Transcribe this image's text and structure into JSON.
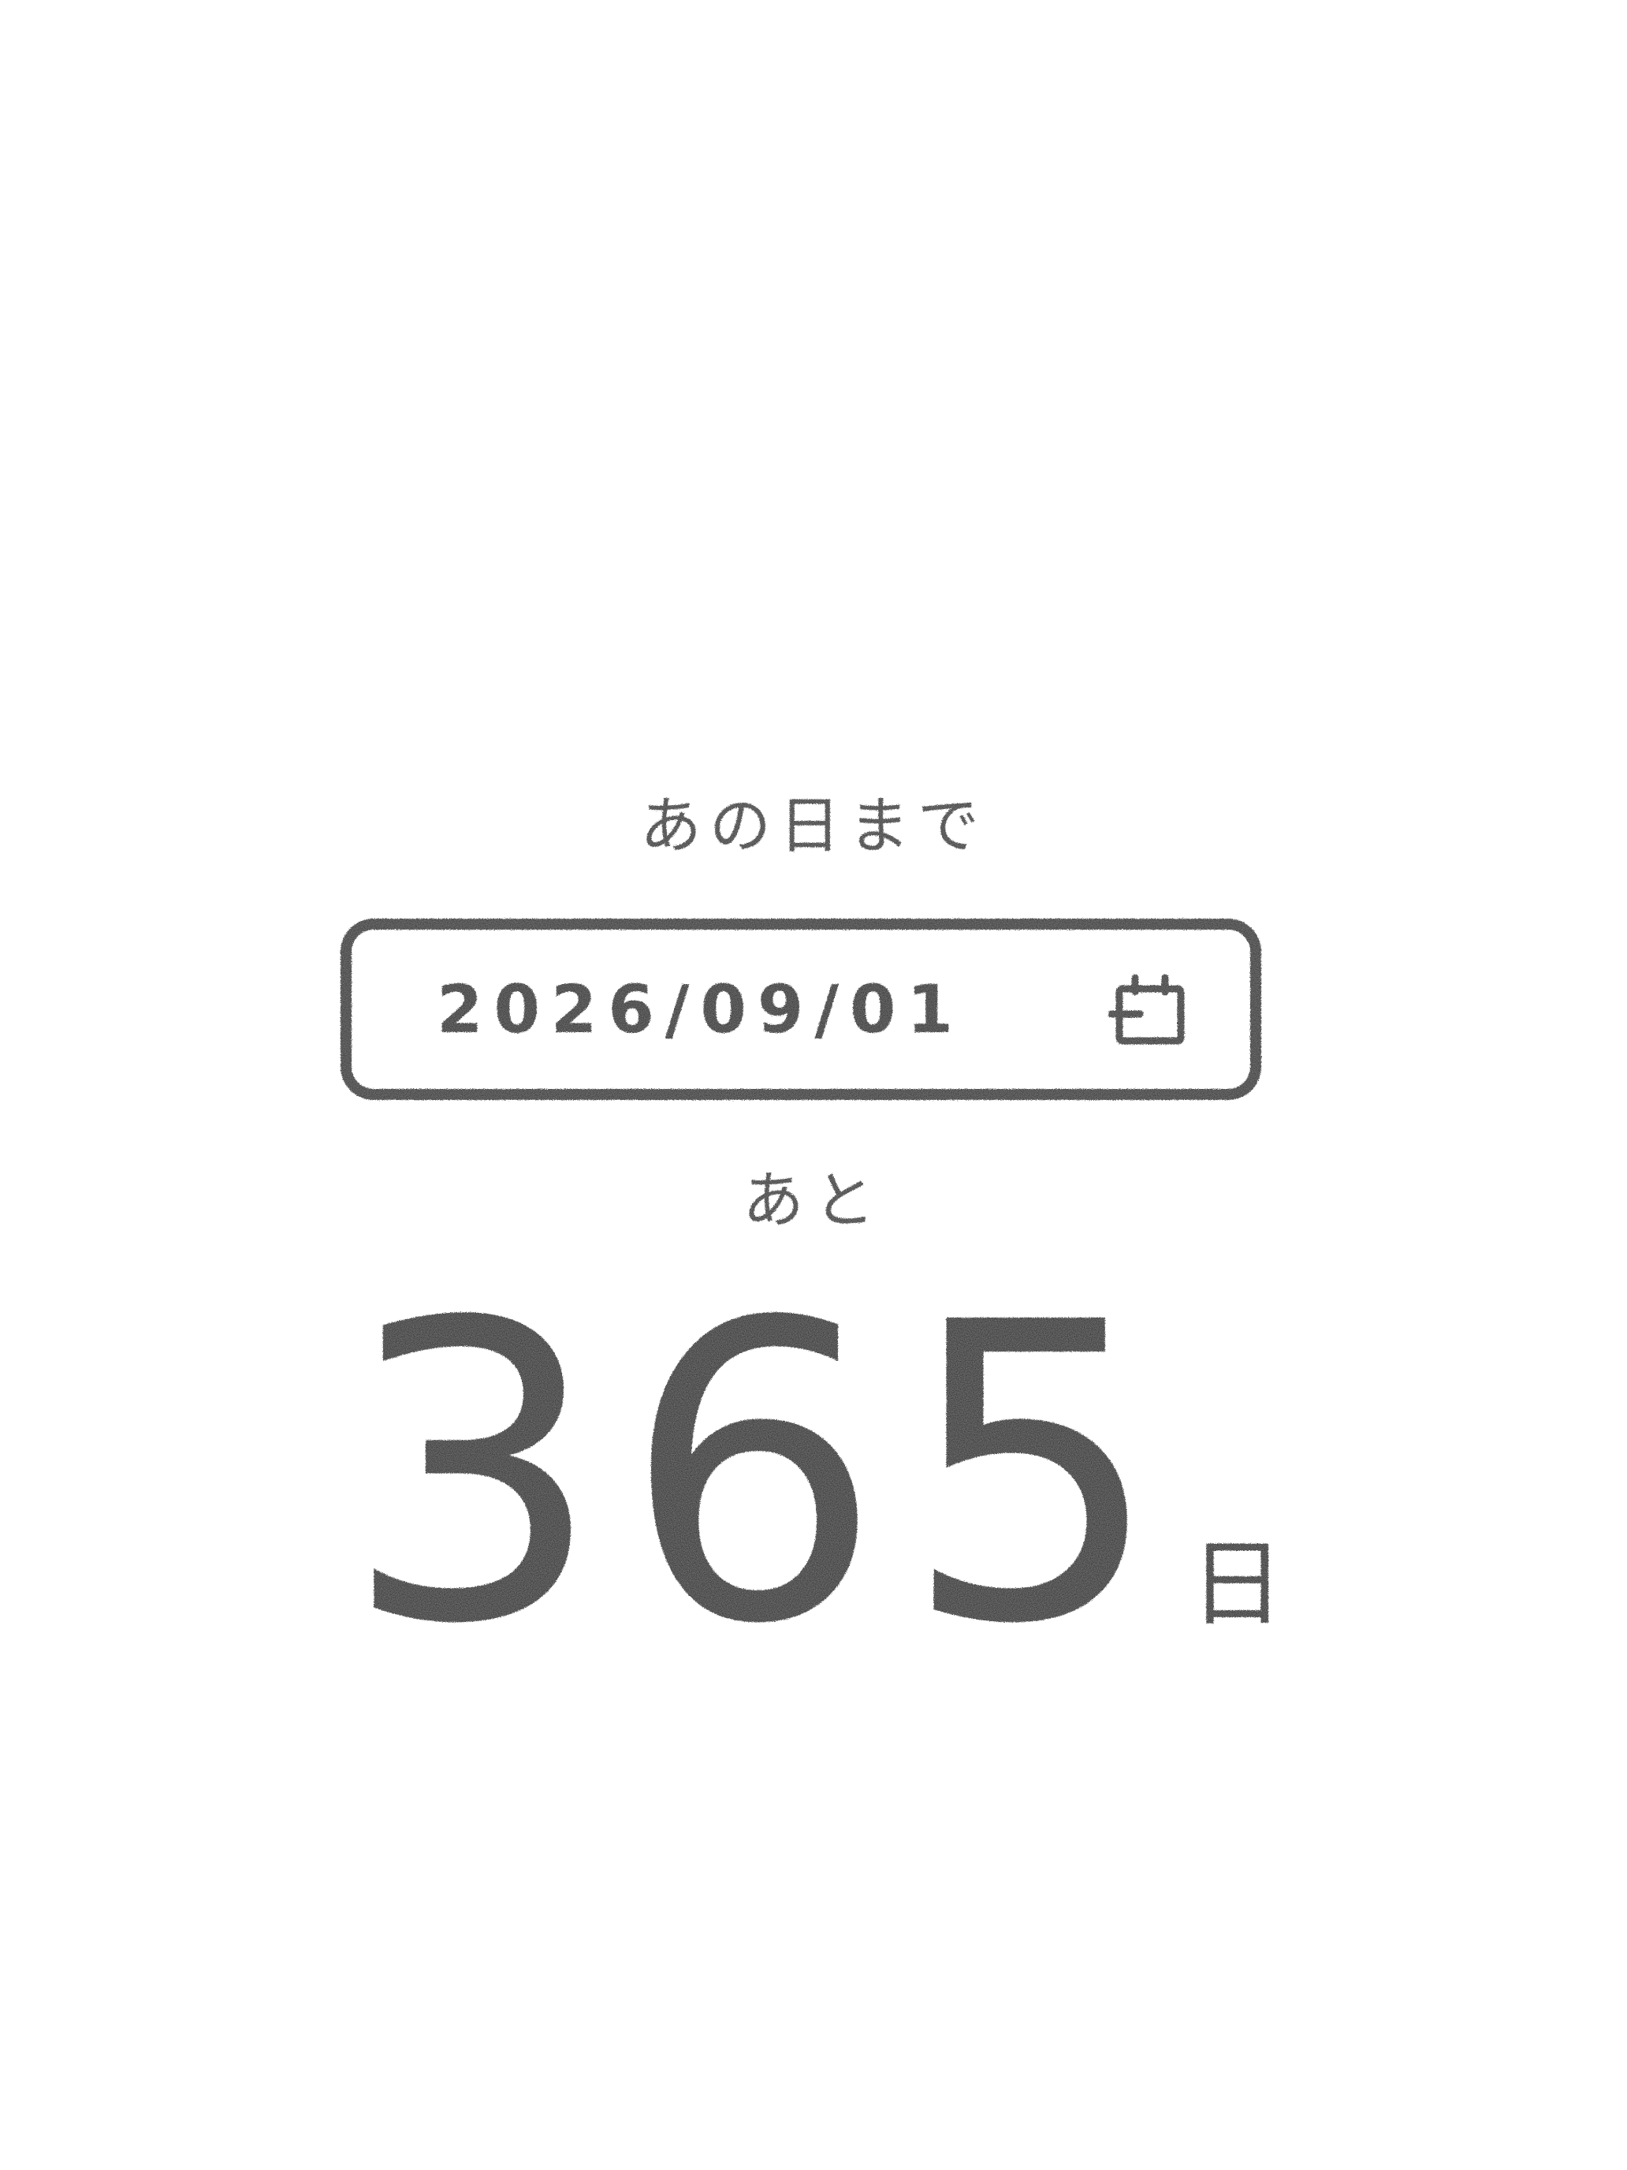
{
  "header": {
    "title": "あの日まで"
  },
  "date_input": {
    "value": "2026/09/01",
    "icon": "calendar-icon"
  },
  "countdown": {
    "prefix": "あと",
    "days": "365",
    "unit": "日"
  },
  "colors": {
    "ink": "#2b2b2b",
    "background": "#ffffff"
  }
}
